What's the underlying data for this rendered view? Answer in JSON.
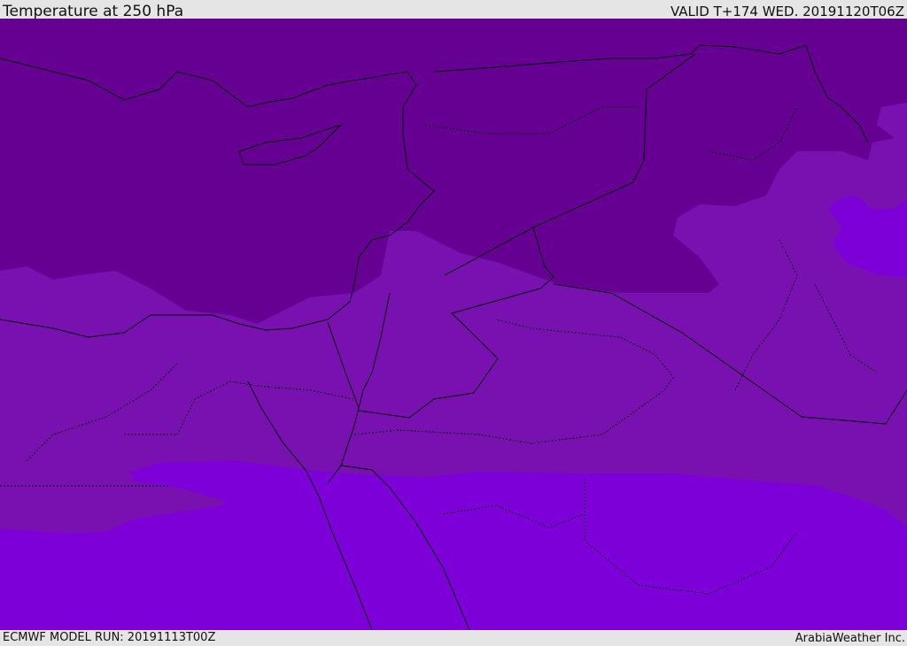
{
  "header": {
    "title": "Temperature at 250 hPa",
    "valid": "VALID T+174 WED. 20191120T06Z"
  },
  "footer": {
    "model_run": "ECMWF MODEL RUN: 20191113T00Z",
    "credit": "ArabiaWeather Inc."
  },
  "colors": {
    "cold_dark": "#650093",
    "mid": "#7811b0",
    "warm_bright": "#7e00d9",
    "border": "#000000"
  }
}
